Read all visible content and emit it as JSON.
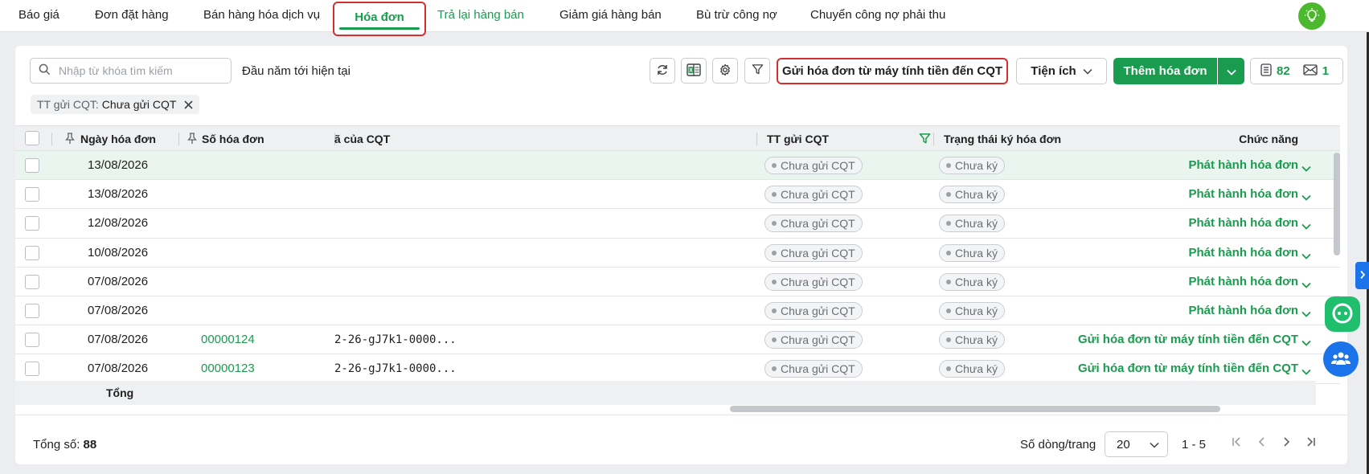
{
  "tabs": [
    {
      "label": "Báo giá"
    },
    {
      "label": "Đơn đặt hàng"
    },
    {
      "label": "Bán hàng hóa dịch vụ"
    },
    {
      "label": "Hóa đơn"
    },
    {
      "label": "Trả lại hàng bán"
    },
    {
      "label": "Giảm giá hàng bán"
    },
    {
      "label": "Bù trừ công nợ"
    },
    {
      "label": "Chuyển công nợ phải thu"
    }
  ],
  "toolbar": {
    "search_placeholder": "Nhập từ khóa tìm kiếm",
    "period": "Đầu năm tới hiện tại",
    "send_button": "Gửi hóa đơn từ máy tính tiền đến CQT",
    "utilities_button": "Tiện ích",
    "add_button": "Thêm hóa đơn",
    "count_list": "82",
    "count_mail": "1"
  },
  "filter_chip": {
    "label": "TT gửi CQT:",
    "value": "Chưa gửi CQT"
  },
  "columns": {
    "date": "Ngày hóa đơn",
    "number": "Số hóa đơn",
    "code": "ã của CQT",
    "cqt_status": "TT gửi CQT",
    "sign_status": "Trạng thái ký hóa đơn",
    "actions": "Chức năng"
  },
  "rows": [
    {
      "date": "13/08/2026",
      "number": "",
      "code": "",
      "cqt": "Chưa gửi CQT",
      "sign": "Chưa ký",
      "action": "Phát hành hóa đơn"
    },
    {
      "date": "13/08/2026",
      "number": "",
      "code": "",
      "cqt": "Chưa gửi CQT",
      "sign": "Chưa ký",
      "action": "Phát hành hóa đơn"
    },
    {
      "date": "12/08/2026",
      "number": "",
      "code": "",
      "cqt": "Chưa gửi CQT",
      "sign": "Chưa ký",
      "action": "Phát hành hóa đơn"
    },
    {
      "date": "10/08/2026",
      "number": "",
      "code": "",
      "cqt": "Chưa gửi CQT",
      "sign": "Chưa ký",
      "action": "Phát hành hóa đơn"
    },
    {
      "date": "07/08/2026",
      "number": "",
      "code": "",
      "cqt": "Chưa gửi CQT",
      "sign": "Chưa ký",
      "action": "Phát hành hóa đơn"
    },
    {
      "date": "07/08/2026",
      "number": "",
      "code": "",
      "cqt": "Chưa gửi CQT",
      "sign": "Chưa ký",
      "action": "Phát hành hóa đơn"
    },
    {
      "date": "07/08/2026",
      "number": "00000124",
      "code": "2-26-gJ7k1-0000...",
      "cqt": "Chưa gửi CQT",
      "sign": "Chưa ký",
      "action": "Gửi hóa đơn từ máy tính tiền đến CQT"
    },
    {
      "date": "07/08/2026",
      "number": "00000123",
      "code": "2-26-gJ7k1-0000...",
      "cqt": "Chưa gửi CQT",
      "sign": "Chưa ký",
      "action": "Gửi hóa đơn từ máy tính tiền đến CQT"
    }
  ],
  "total_row_label": "Tổng",
  "footer": {
    "total_label": "Tổng số:",
    "total_value": "88",
    "per_page_label": "Số dòng/trang",
    "per_page_value": "20",
    "range": "1 - 5"
  },
  "colors": {
    "accent": "#1a9c4e",
    "highlight": "#d32f2f",
    "selected_row": "#e9f5ee"
  }
}
